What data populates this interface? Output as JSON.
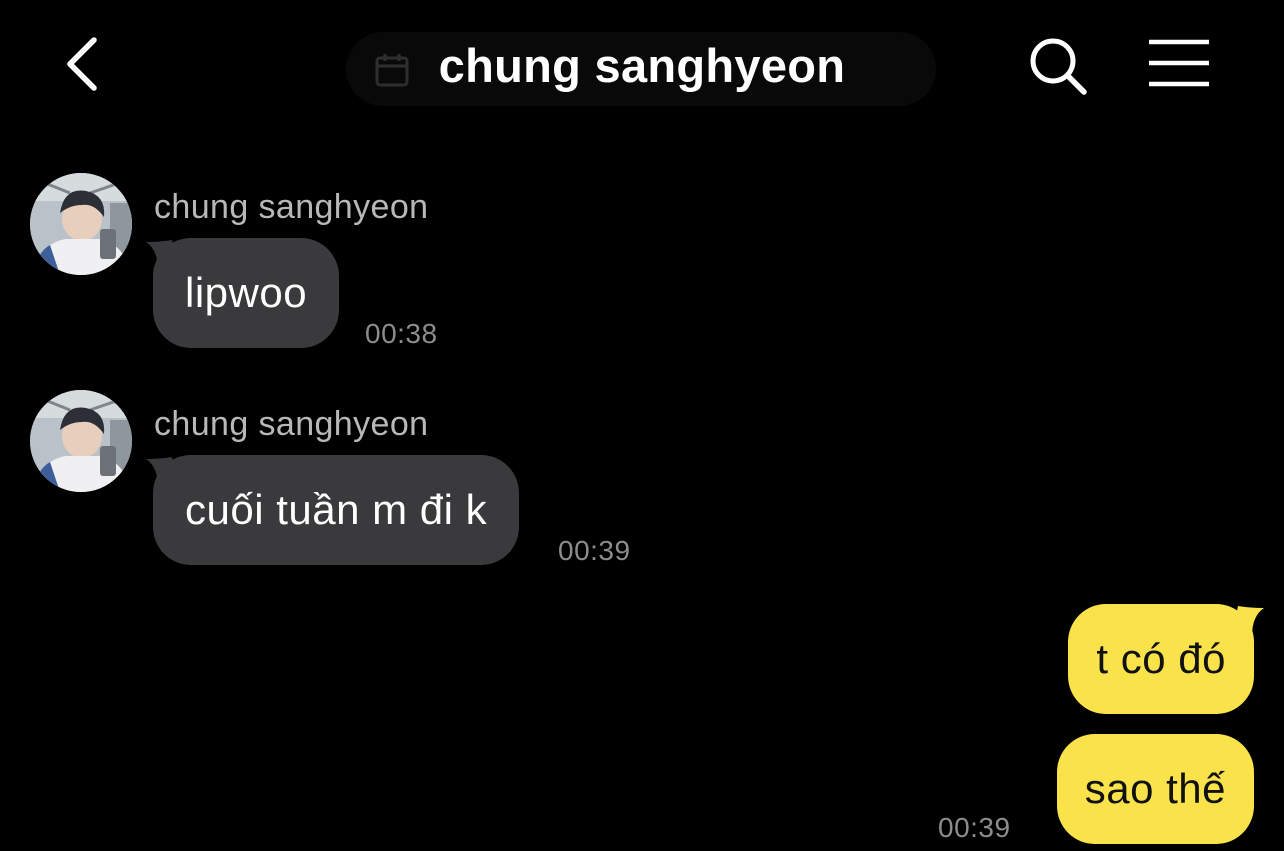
{
  "header": {
    "title": "chung sanghyeon",
    "back_icon": "chevron-left-icon",
    "search_icon": "search-icon",
    "menu_icon": "hamburger-menu-icon"
  },
  "messages": [
    {
      "sender": "chung sanghyeon",
      "text": "lipwoo",
      "time": "00:38",
      "direction": "incoming"
    },
    {
      "sender": "chung sanghyeon",
      "text": "cuối tuần m đi k",
      "time": "00:39",
      "direction": "incoming"
    },
    {
      "text": "t có đó",
      "direction": "outgoing"
    },
    {
      "text": "sao thế",
      "time": "00:39",
      "direction": "outgoing"
    }
  ],
  "colors": {
    "background": "#000000",
    "incoming_bubble": "#3a3a3c",
    "outgoing_bubble": "#fae34a",
    "timestamp": "#8c8c8c",
    "sender_name": "#b8b8b8"
  }
}
